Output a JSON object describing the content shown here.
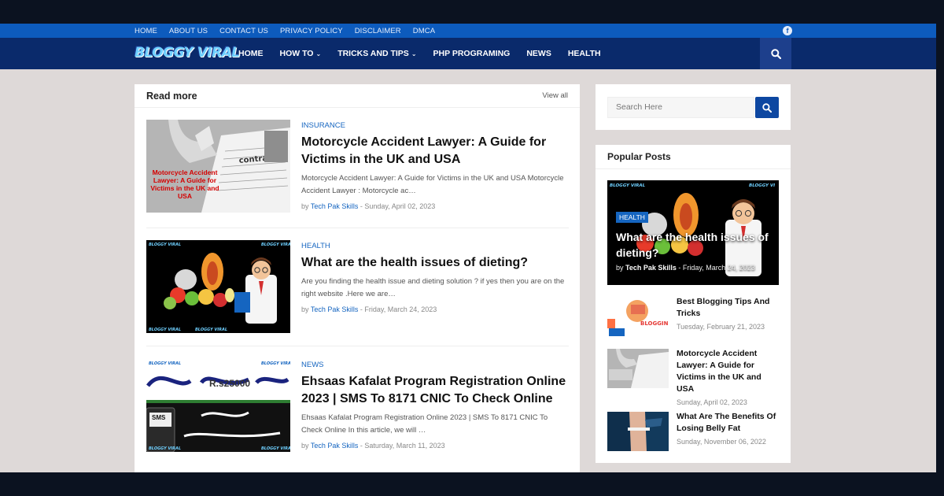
{
  "topbar": {
    "links": [
      "HOME",
      "ABOUT US",
      "CONTACT US",
      "PRIVACY POLICY",
      "DISCLAIMER",
      "DMCA"
    ],
    "social_icon": "facebook-icon"
  },
  "navbar": {
    "logo": "BLOGGY VIRAL",
    "items": [
      {
        "label": "HOME",
        "dropdown": false
      },
      {
        "label": "HOW TO",
        "dropdown": true
      },
      {
        "label": "TRICKS AND TIPS",
        "dropdown": true
      },
      {
        "label": "PHP PROGRAMING",
        "dropdown": false
      },
      {
        "label": "NEWS",
        "dropdown": false
      },
      {
        "label": "HEALTH",
        "dropdown": false
      }
    ],
    "search_icon": "search-icon"
  },
  "main": {
    "title": "Read more",
    "view_all": "View all",
    "posts": [
      {
        "category": "INSURANCE",
        "title": "Motorcycle Accident Lawyer: A Guide for Victims in the UK and USA",
        "excerpt": "Motorcycle Accident Lawyer: A Guide for Victims in the UK and USA Motorcycle Accident Lawyer : Motorcycle ac…",
        "by": "by",
        "author": "Tech Pak Skills",
        "date": "- Sunday, April 02, 2023",
        "thumb_text": "Motorcycle Accident Lawyer: A Guide for Victims in the UK and USA"
      },
      {
        "category": "HEALTH",
        "title": "What are the health issues of dieting?",
        "excerpt": "Are you finding the health issue and dieting solution ? if yes then you are on the right website .Here we are…",
        "by": "by",
        "author": "Tech Pak Skills",
        "date": "- Friday, March 24, 2023"
      },
      {
        "category": "NEWS",
        "title": "Ehsaas Kafalat Program Registration Online 2023 | SMS To 8171 CNIC To Check Online",
        "excerpt": "Ehsaas Kafalat Program Registration Online 2023 | SMS To 8171 CNIC To Check Online In this article, we will …",
        "by": "by",
        "author": "Tech Pak Skills",
        "date": "- Saturday, March 11, 2023",
        "thumb_amount": "R.s25000",
        "thumb_sms": "SMS"
      }
    ]
  },
  "sidebar": {
    "search_placeholder": "Search Here",
    "popular_title": "Popular Posts",
    "featured": {
      "badge": "HEALTH",
      "title": "What are the health issues of dieting?",
      "by": "by",
      "author": "Tech Pak Skills",
      "date": "- Friday, March 24, 2023"
    },
    "items": [
      {
        "title": "Best Blogging Tips And Tricks",
        "date": "Tuesday, February 21, 2023",
        "thumb_text": "BLOGGIN"
      },
      {
        "title": "Motorcycle Accident Lawyer: A Guide for Victims in the UK and USA",
        "date": "Sunday, April 02, 2023"
      },
      {
        "title": "What Are The Benefits Of Losing Belly Fat",
        "date": "Sunday, November 06, 2022"
      }
    ]
  },
  "colors": {
    "topbar": "#0d5bbd",
    "navbar": "#0a2a6b",
    "accent": "#1565c0",
    "background": "#ded9d8"
  }
}
